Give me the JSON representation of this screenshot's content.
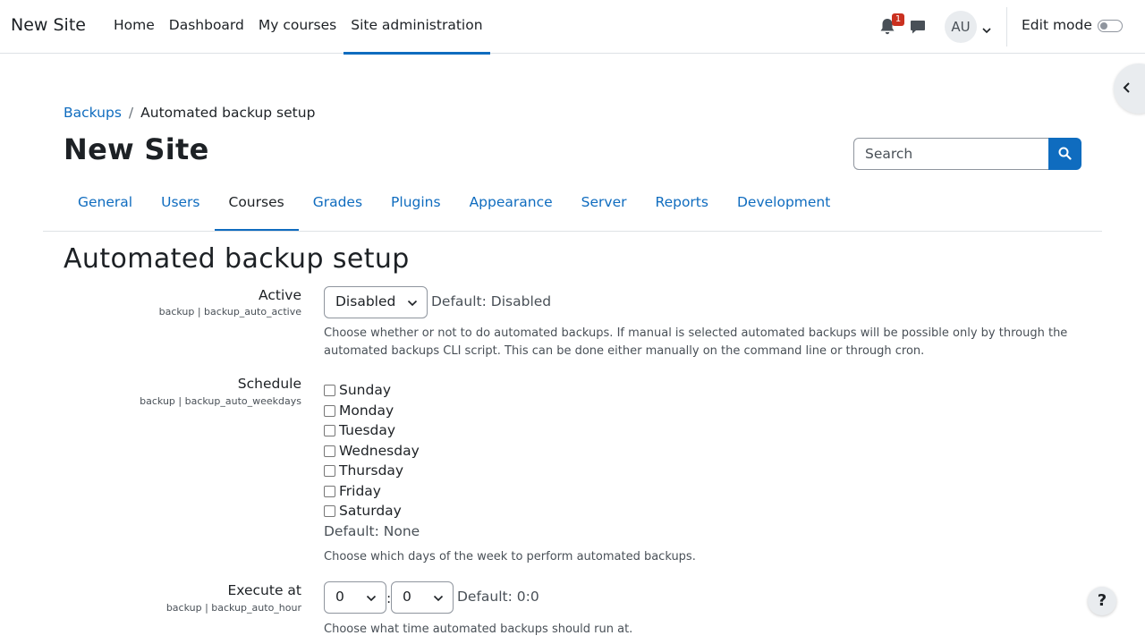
{
  "navbar": {
    "brand": "New Site",
    "items": [
      {
        "label": "Home"
      },
      {
        "label": "Dashboard"
      },
      {
        "label": "My courses"
      },
      {
        "label": "Site administration"
      }
    ],
    "notification_count": "1",
    "avatar_initials": "AU",
    "edit_mode_label": "Edit mode"
  },
  "breadcrumb": {
    "items": [
      {
        "label": "Backups"
      },
      {
        "label": "Automated backup setup"
      }
    ],
    "separator": "/"
  },
  "page": {
    "title": "New Site",
    "search_placeholder": "Search"
  },
  "tabs": [
    {
      "label": "General"
    },
    {
      "label": "Users"
    },
    {
      "label": "Courses"
    },
    {
      "label": "Grades"
    },
    {
      "label": "Plugins"
    },
    {
      "label": "Appearance"
    },
    {
      "label": "Server"
    },
    {
      "label": "Reports"
    },
    {
      "label": "Development"
    }
  ],
  "section_title": "Automated backup setup",
  "settings": {
    "active": {
      "label": "Active",
      "key": "backup | backup_auto_active",
      "value": "Disabled",
      "default": "Default: Disabled",
      "help": "Choose whether or not to do automated backups. If manual is selected automated backups will be possible only by through the automated backups CLI script. This can be done either manually on the command line or through cron."
    },
    "schedule": {
      "label": "Schedule",
      "key": "backup | backup_auto_weekdays",
      "days": [
        {
          "label": "Sunday"
        },
        {
          "label": "Monday"
        },
        {
          "label": "Tuesday"
        },
        {
          "label": "Wednesday"
        },
        {
          "label": "Thursday"
        },
        {
          "label": "Friday"
        },
        {
          "label": "Saturday"
        }
      ],
      "default": "Default: None",
      "help": "Choose which days of the week to perform automated backups."
    },
    "execute_at": {
      "label": "Execute at",
      "key": "backup | backup_auto_hour",
      "hour": "0",
      "minute": "0",
      "separator": ":",
      "default": "Default: 0:0",
      "help": "Choose what time automated backups should run at."
    }
  },
  "help_button": "?",
  "colors": {
    "primary": "#0f6cbf",
    "badge": "#ca3120",
    "text": "#1d2125",
    "muted": "#495057"
  }
}
